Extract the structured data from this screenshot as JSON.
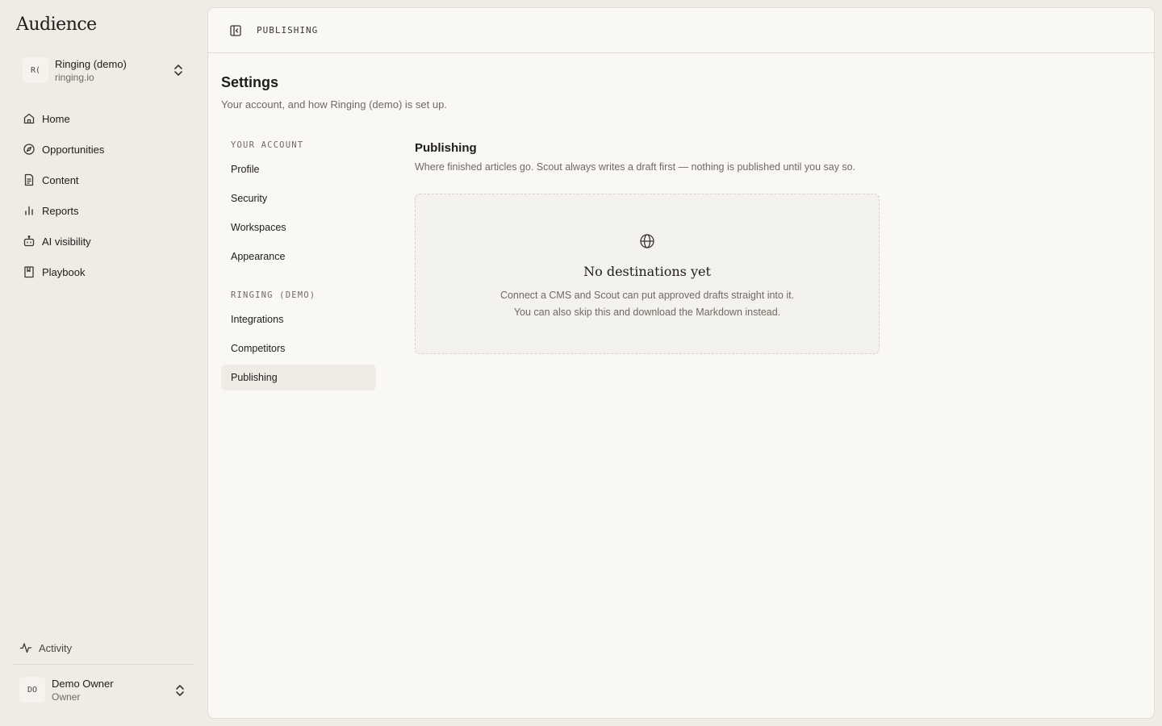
{
  "app": {
    "brand": "Audience"
  },
  "workspace": {
    "initials": "R(",
    "name": "Ringing (demo)",
    "domain": "ringing.io"
  },
  "nav": {
    "items": [
      {
        "label": "Home",
        "icon": "home-icon"
      },
      {
        "label": "Opportunities",
        "icon": "compass-icon"
      },
      {
        "label": "Content",
        "icon": "document-icon"
      },
      {
        "label": "Reports",
        "icon": "bar-chart-icon"
      },
      {
        "label": "AI visibility",
        "icon": "robot-icon"
      },
      {
        "label": "Playbook",
        "icon": "book-icon"
      }
    ]
  },
  "footer": {
    "activity_label": "Activity",
    "user": {
      "initials": "DO",
      "name": "Demo Owner",
      "role": "Owner"
    }
  },
  "topbar": {
    "breadcrumb": "PUBLISHING"
  },
  "settings": {
    "title": "Settings",
    "subtitle": "Your account, and how Ringing (demo) is set up.",
    "account_heading": "YOUR ACCOUNT",
    "account_items": [
      "Profile",
      "Security",
      "Workspaces",
      "Appearance"
    ],
    "workspace_heading": "RINGING (DEMO)",
    "workspace_items": [
      "Integrations",
      "Competitors",
      "Publishing"
    ],
    "active_item": "Publishing"
  },
  "publishing": {
    "title": "Publishing",
    "description": "Where finished articles go. Scout always writes a draft first — nothing is published until you say so.",
    "empty_title": "No destinations yet",
    "empty_text": "Connect a CMS and Scout can put approved drafts straight into it. You can also skip this and download the Markdown instead."
  }
}
